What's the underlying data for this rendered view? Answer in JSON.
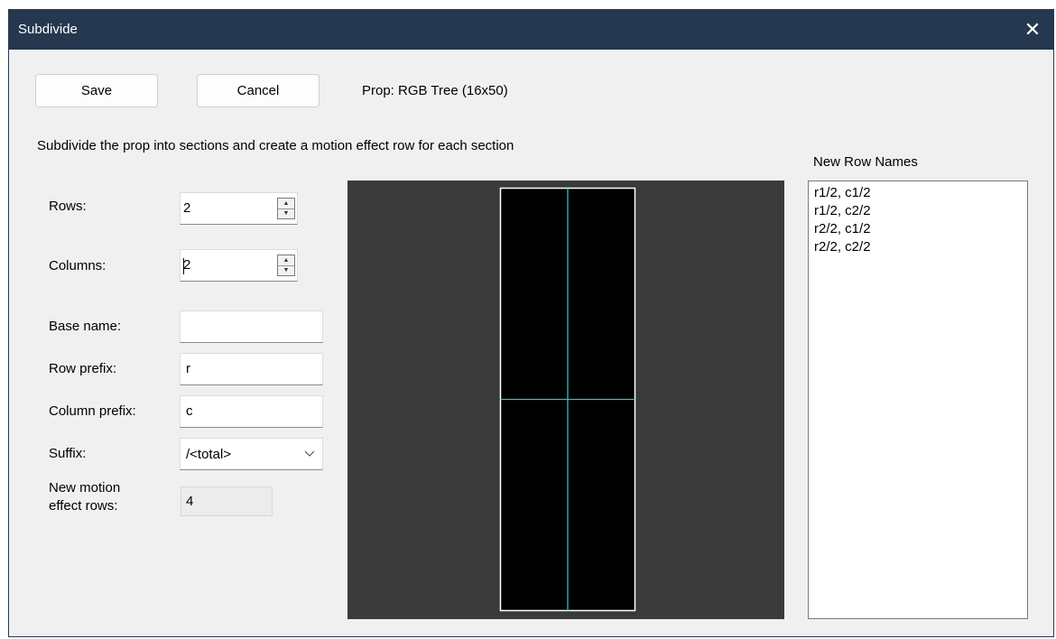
{
  "window": {
    "title": "Subdivide"
  },
  "toolbar": {
    "save_label": "Save",
    "cancel_label": "Cancel",
    "prop_info": "Prop: RGB Tree (16x50)"
  },
  "description": "Subdivide the prop into sections and create a motion effect row for each section",
  "form": {
    "rows_label": "Rows:",
    "rows_value": "2",
    "columns_label": "Columns:",
    "columns_value": "2",
    "base_name_label": "Base name:",
    "base_name_value": "",
    "row_prefix_label": "Row prefix:",
    "row_prefix_value": "r",
    "column_prefix_label": "Column prefix:",
    "column_prefix_value": "c",
    "suffix_label": "Suffix:",
    "suffix_value": "/<total>",
    "new_rows_label_line1": "New motion",
    "new_rows_label_line2": "effect rows:",
    "new_rows_value": "4"
  },
  "preview": {
    "background_color": "#3a3a3a",
    "prop_fill": "#000000",
    "prop_border": "#ffffff",
    "divider_color": "#1ec8d2",
    "rows": 2,
    "columns": 2
  },
  "row_names": {
    "header": "New Row Names",
    "items": [
      "r1/2, c1/2",
      "r1/2, c2/2",
      "r2/2, c1/2",
      "r2/2, c2/2"
    ]
  },
  "icons": {
    "close": "close-icon",
    "spin_up": "spin-up-icon",
    "spin_down": "spin-down-icon",
    "dropdown": "chevron-down-icon"
  }
}
